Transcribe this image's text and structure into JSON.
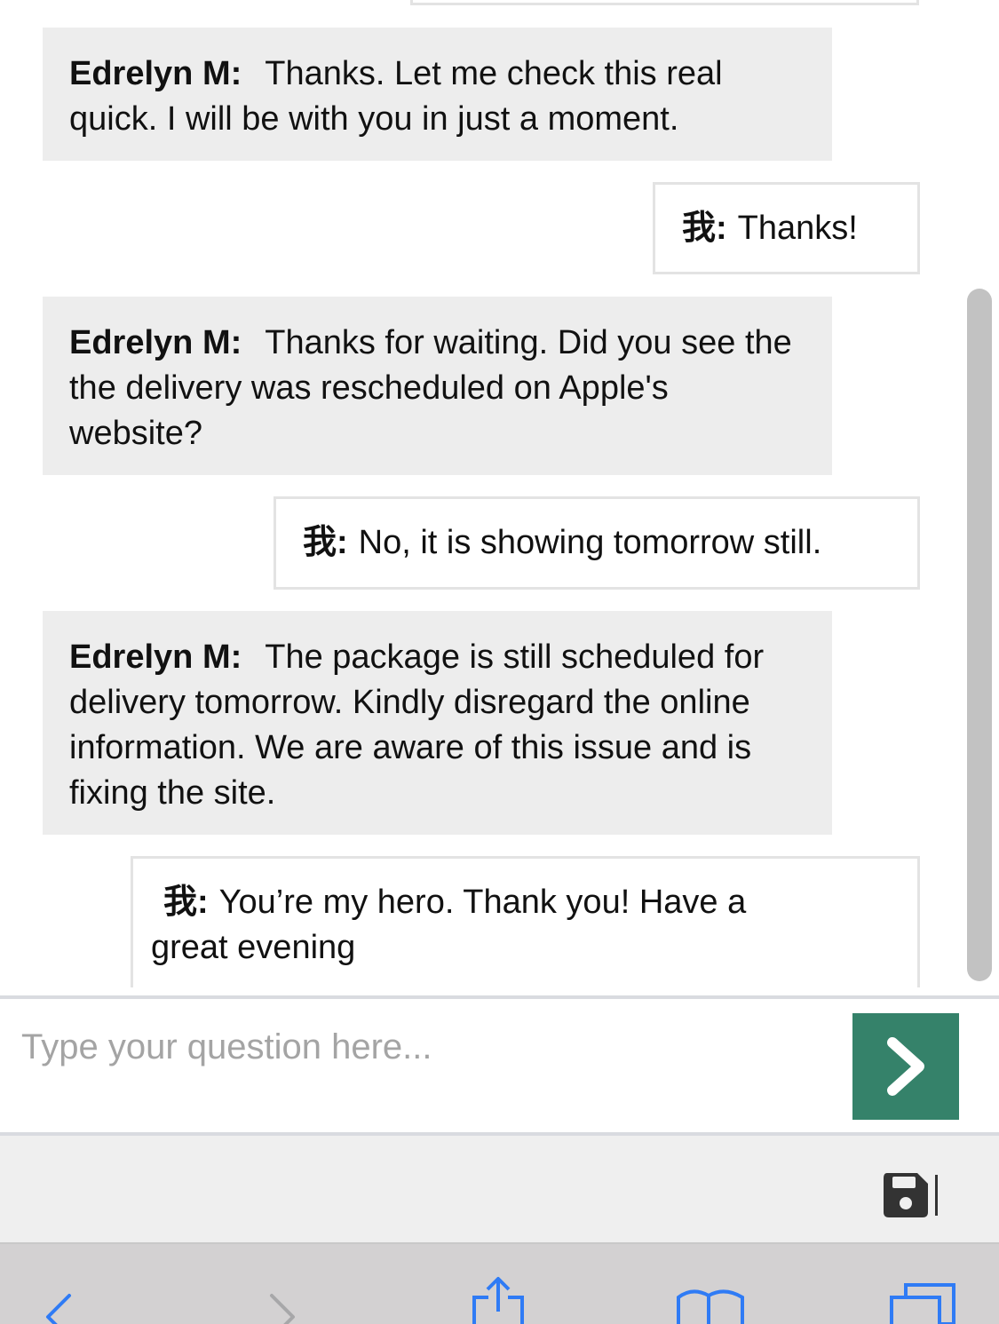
{
  "chat": {
    "messages": [
      {
        "role": "agent",
        "sender": "Edrelyn M:",
        "text": "Thanks. Let me check this real quick. I will be with you in just a moment."
      },
      {
        "role": "user",
        "sender": "我:",
        "text": "Thanks!"
      },
      {
        "role": "agent",
        "sender": "Edrelyn M:",
        "text": "Thanks for waiting. Did you see the the delivery was rescheduled on Apple's website?"
      },
      {
        "role": "user",
        "sender": "我:",
        "text": "No, it is showing tomorrow still."
      },
      {
        "role": "agent",
        "sender": "Edrelyn M:",
        "text": "The package is still scheduled for delivery tomorrow. Kindly disregard the online information. We are aware of this issue and is fixing the site."
      },
      {
        "role": "user",
        "sender": "我:",
        "text": "You’re my hero. Thank you! Have a great evening"
      }
    ]
  },
  "compose": {
    "placeholder": "Type your question here...",
    "value": "",
    "send_icon": "chevron-right-icon"
  },
  "toolbar": {
    "save_icon": "floppy-disk-icon"
  },
  "browser_bar": {
    "icons": [
      "back-icon",
      "forward-icon",
      "share-icon",
      "bookmarks-icon",
      "tabs-icon"
    ]
  },
  "colors": {
    "agent_bubble": "#ededed",
    "user_border": "#e3e3e3",
    "send_button": "#35826a",
    "browser_bar": "#d3d1d2",
    "ios_blue": "#2f7bf5"
  }
}
